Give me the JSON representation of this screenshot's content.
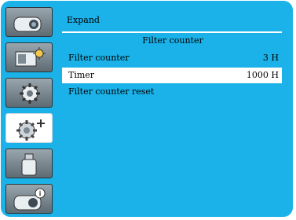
{
  "sidebar": {
    "items": [
      {
        "icon": "display-icon",
        "active": false
      },
      {
        "icon": "picture-adjust-icon",
        "active": false
      },
      {
        "icon": "settings-gear-icon",
        "active": false
      },
      {
        "icon": "expand-gear-icon",
        "active": true
      },
      {
        "icon": "usb-memory-icon",
        "active": false
      },
      {
        "icon": "information-icon",
        "active": false
      }
    ]
  },
  "panel": {
    "title": "Expand",
    "subtitle": "Filter counter",
    "rows": [
      {
        "label": "Filter counter",
        "value": "3  H",
        "selected": false
      },
      {
        "label": "Timer",
        "value": "1000 H",
        "selected": true
      },
      {
        "label": "Filter counter reset",
        "value": "",
        "selected": false
      }
    ]
  },
  "colors": {
    "frame": "#1ab2e8",
    "highlight": "#ffffff",
    "tab_inactive": "#7c878f"
  }
}
